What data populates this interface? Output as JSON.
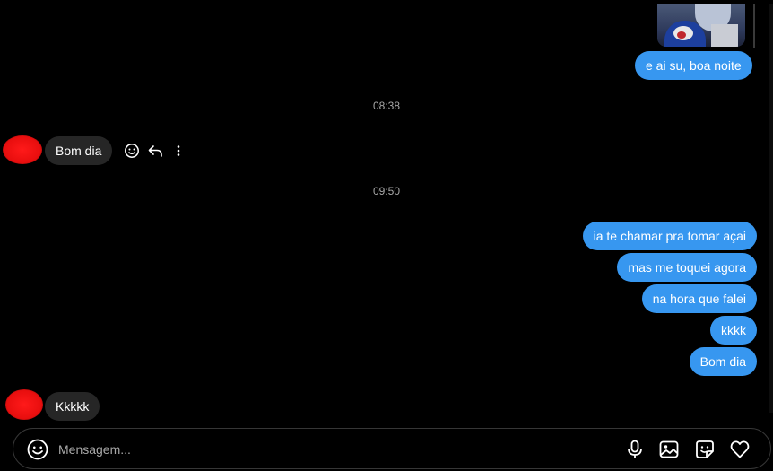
{
  "thread": {
    "messages_top": [
      {
        "text": "e ai su, boa noite"
      }
    ],
    "time_1": "08:38",
    "received_1": "Bom dia",
    "time_2": "09:50",
    "sent_group": [
      "ia te chamar pra tomar açai",
      "mas me toquei agora",
      "na hora que falei",
      "kkkk",
      "Bom dia"
    ],
    "received_2": "Kkkkk"
  },
  "composer": {
    "placeholder": "Mensagem..."
  },
  "colors": {
    "background": "#000000",
    "sent_bubble": "#3797f0",
    "received_bubble": "#262626",
    "timestamp": "#a8a8a8",
    "avatar_scribble": "#e80e0e"
  },
  "icons": {
    "message_actions": [
      "emoji-react-icon",
      "reply-icon",
      "more-options-icon"
    ],
    "composer_left": "emoji-icon",
    "composer_right": [
      "microphone-icon",
      "image-icon",
      "sticker-icon",
      "heart-icon"
    ]
  }
}
